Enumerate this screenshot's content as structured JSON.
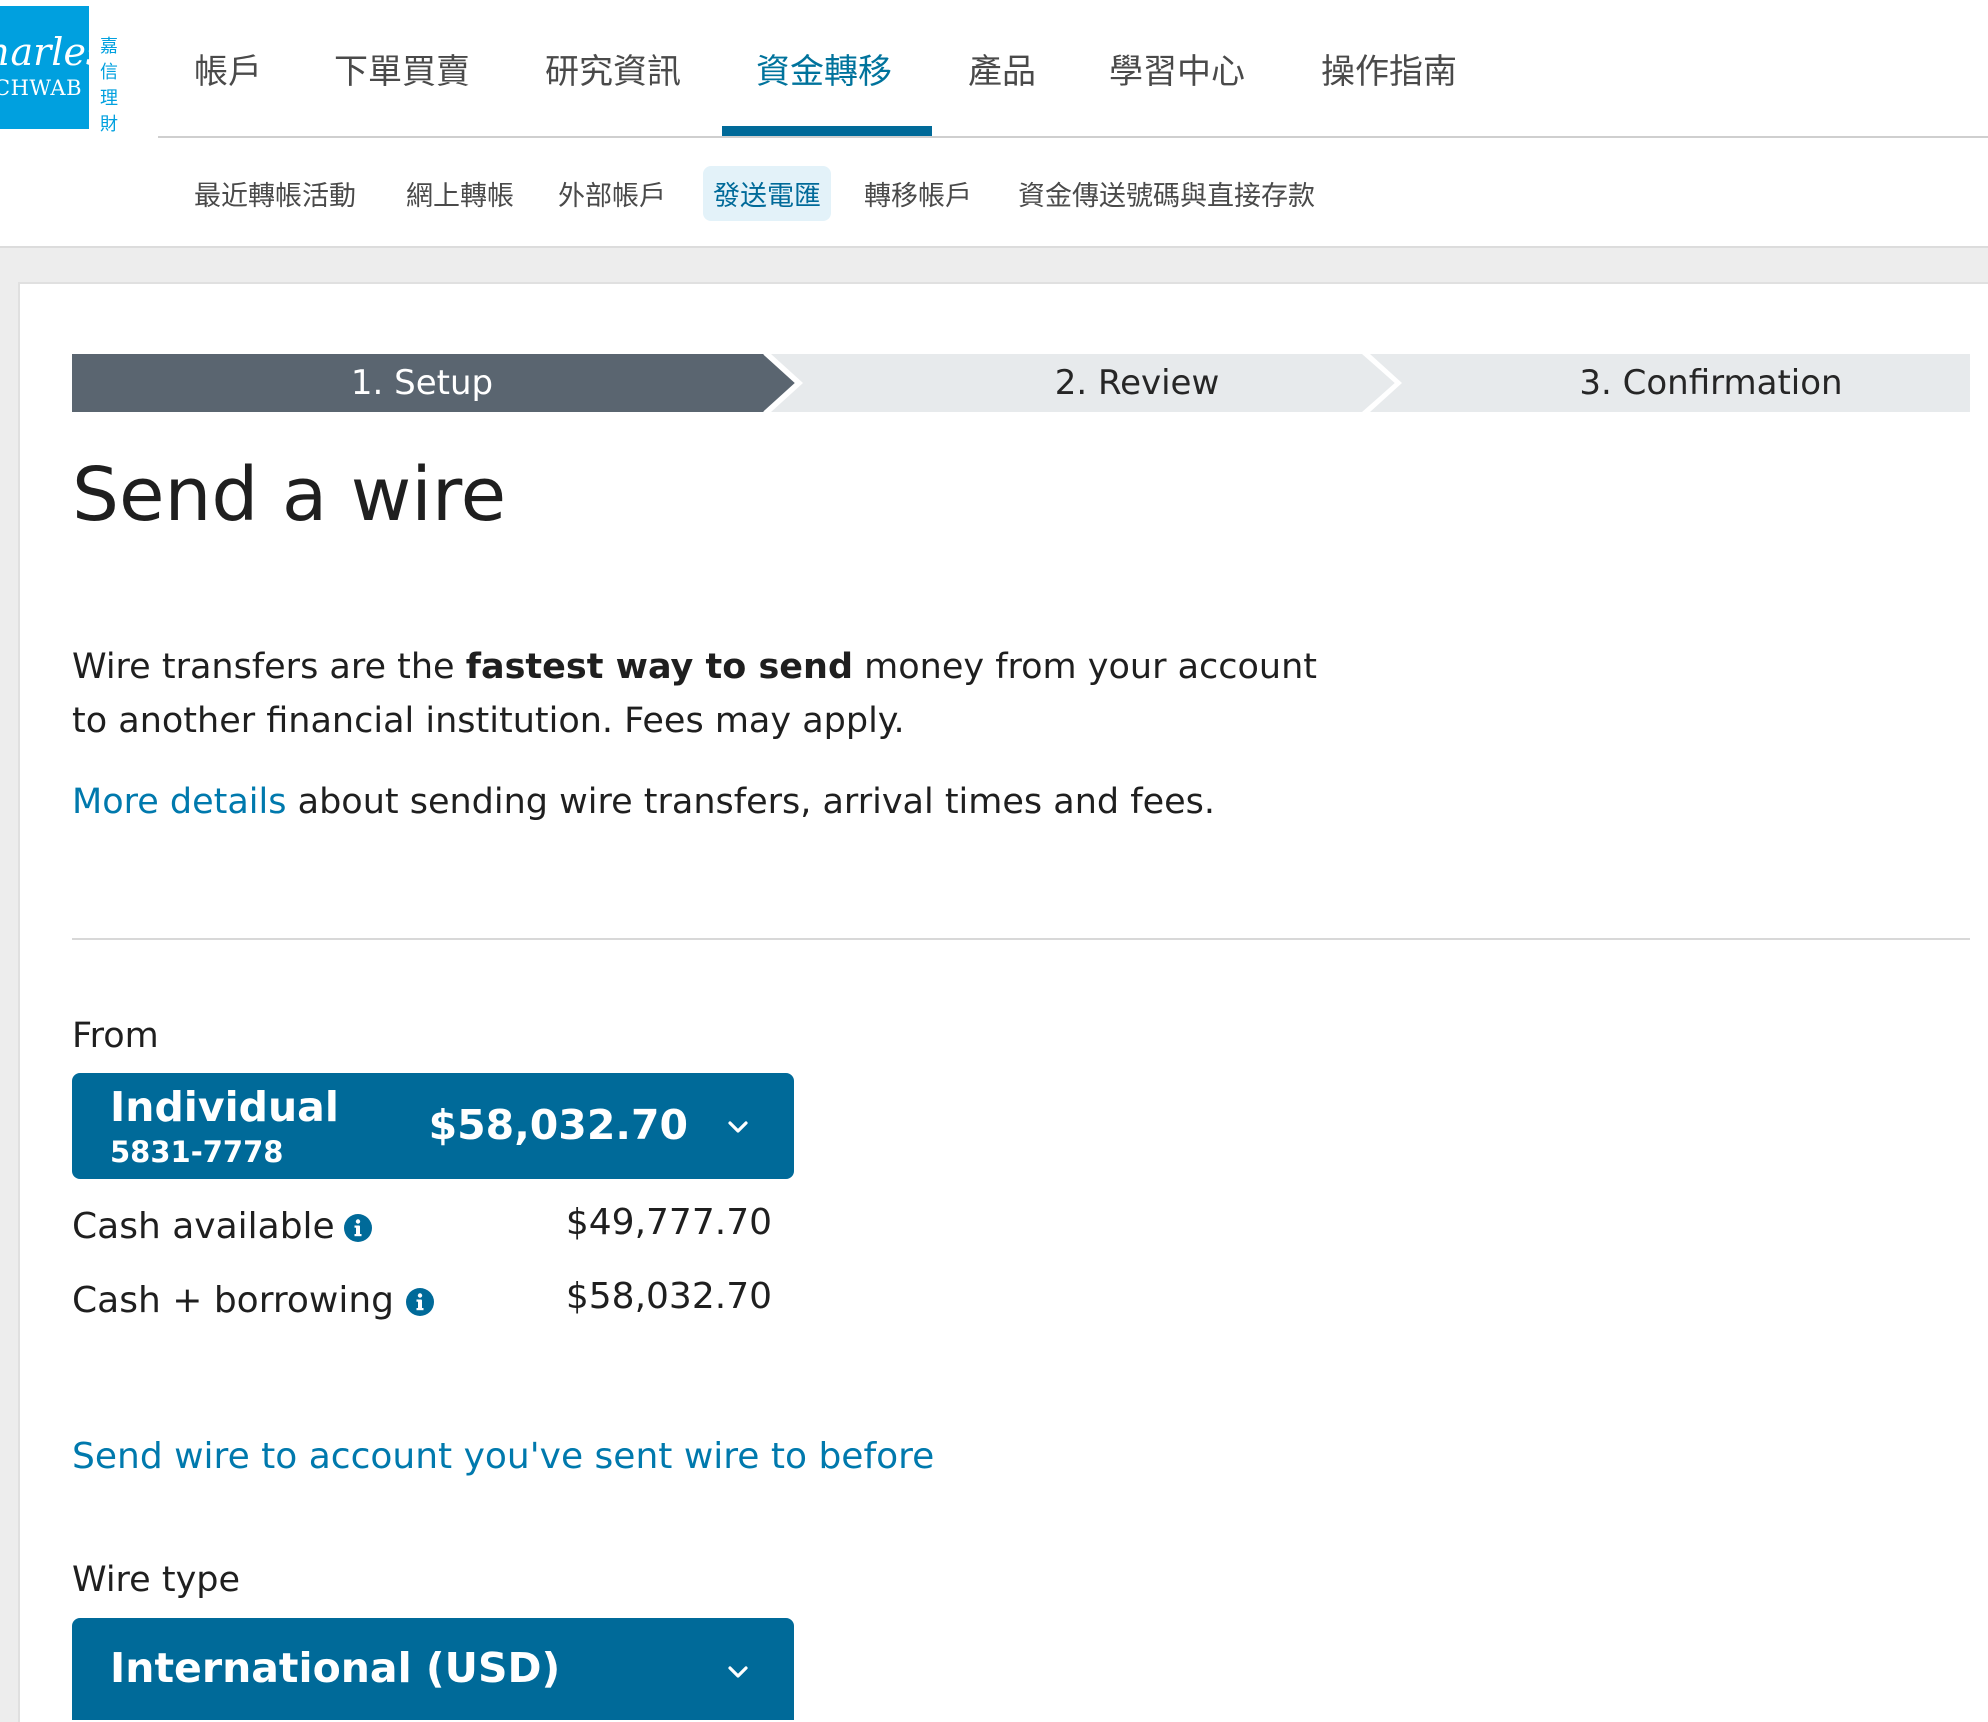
{
  "logo": {
    "line1": "harles",
    "line2": "CHWAB",
    "chinese": "嘉\n信\n理\n財"
  },
  "main_nav": {
    "items": [
      {
        "label": "帳戶"
      },
      {
        "label": "下單買賣"
      },
      {
        "label": "研究資訊"
      },
      {
        "label": "資金轉移",
        "active": true
      },
      {
        "label": "產品"
      },
      {
        "label": "學習中心"
      },
      {
        "label": "操作指南"
      }
    ]
  },
  "sub_nav": {
    "items": [
      {
        "label": "最近轉帳活動"
      },
      {
        "label": "網上轉帳"
      },
      {
        "label": "外部帳戶"
      },
      {
        "label": "發送電匯",
        "active": true
      },
      {
        "label": "轉移帳戶"
      },
      {
        "label": "資金傳送號碼與直接存款"
      }
    ]
  },
  "stepper": {
    "steps": [
      {
        "label": "1. Setup",
        "state": "active"
      },
      {
        "label": "2. Review",
        "state": "upcoming"
      },
      {
        "label": "3. Confirmation",
        "state": "upcoming"
      }
    ]
  },
  "page": {
    "title": "Send a wire",
    "intro_before": "Wire transfers are the ",
    "intro_bold": "fastest way to send",
    "intro_after": " money from your account to another financial institution. Fees may apply.",
    "more_details_link": "More details",
    "more_details_rest": " about sending wire transfers, arrival times and fees."
  },
  "from": {
    "label": "From",
    "account_name": "Individual",
    "account_number": "5831-7778",
    "account_balance": "$58,032.70",
    "cash_available_label": "Cash available",
    "cash_available_value": "$49,777.70",
    "cash_borrowing_label": "Cash + borrowing",
    "cash_borrowing_value": "$58,032.70"
  },
  "sent_before_link": "Send wire to account you've sent wire to before",
  "wire_type": {
    "label": "Wire type",
    "selected": "International (USD)"
  },
  "icons": {
    "info": "info-circle-icon",
    "dropdown": "chevron-down-icon"
  },
  "colors": {
    "brand_blue": "#006a99",
    "link_blue": "#0079ad",
    "logo_blue": "#00a0df",
    "active_step": "#5a6570",
    "inactive_step": "#e7eaec"
  }
}
